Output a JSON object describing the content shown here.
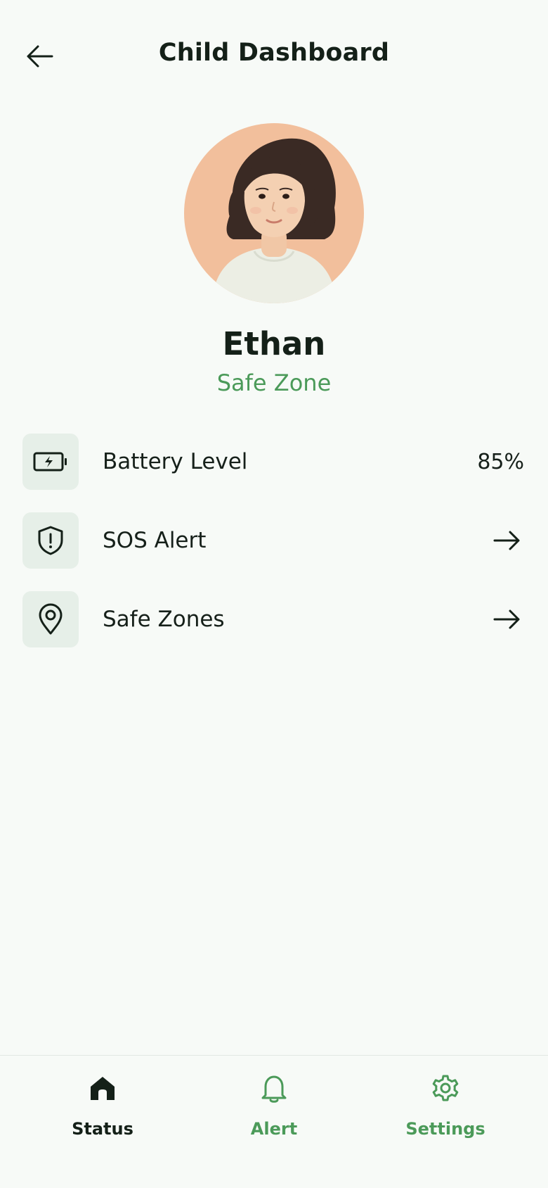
{
  "header": {
    "title": "Child Dashboard",
    "back_icon": "arrow-left-icon"
  },
  "profile": {
    "name": "Ethan",
    "status": "Safe Zone",
    "status_color": "#4b9a59",
    "avatar_bg": "#f2bf9c"
  },
  "rows": [
    {
      "icon": "battery-charging-icon",
      "label": "Battery Level",
      "value": "85%"
    },
    {
      "icon": "shield-alert-icon",
      "label": "SOS Alert",
      "action_icon": "arrow-right-icon"
    },
    {
      "icon": "map-pin-icon",
      "label": "Safe Zones",
      "action_icon": "arrow-right-icon"
    }
  ],
  "nav": {
    "items": [
      {
        "label": "Status",
        "icon": "home-icon",
        "active": true
      },
      {
        "label": "Alert",
        "icon": "bell-icon",
        "active": false
      },
      {
        "label": "Settings",
        "icon": "gear-icon",
        "active": false
      }
    ],
    "active_color": "#142018",
    "inactive_color": "#4b9a59"
  },
  "colors": {
    "background": "#f7faf7",
    "icon_tile": "#e6efe8"
  }
}
